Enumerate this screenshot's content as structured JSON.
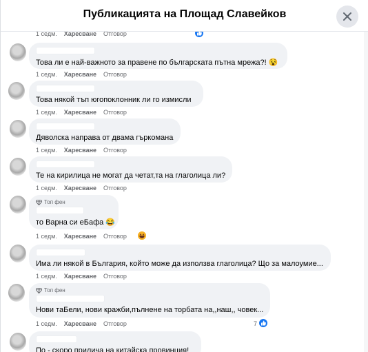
{
  "header": {
    "title": "Публикацията на Площад Славейков"
  },
  "comments": [
    {
      "time": "1 седм.",
      "like": "Харесване",
      "reply": "Отговор"
    },
    {
      "text": "Това ли е най-важното за правене по българската пътна мрежа?! 😵",
      "time": "1 седм.",
      "like": "Харесване",
      "reply": "Отговор"
    },
    {
      "text": "Това някой тъп югопоклонник ли го измисли",
      "time": "1 седм.",
      "like": "Харесване",
      "reply": "Отговор"
    },
    {
      "text": "Дяволска направа от двама гъркомана",
      "time": "1 седм.",
      "like": "Харесване",
      "reply": "Отговор"
    },
    {
      "text": "Те на кирилица не могат да четат,та на глаголица ли?",
      "time": "1 седм.",
      "like": "Харесване",
      "reply": "Отговор"
    },
    {
      "badge": "Топ фен",
      "text": "то Варна си еБафа 😂",
      "time": "1 седм.",
      "like": "Харесване",
      "reply": "Отговор"
    },
    {
      "text": "Има ли някой в България, който може да използва глаголица? Що за малоумие...",
      "time": "1 седм.",
      "like": "Харесване",
      "reply": "Отговор"
    },
    {
      "badge": "Топ фен",
      "text": "Нови таБели, нови кражби,пълнене на торбата на,,наш,, човек...",
      "time": "1 седм.",
      "like": "Харесване",
      "reply": "Отговор",
      "reaction_count": "7"
    },
    {
      "text": "По - скоро прилича на китайска провинция!"
    }
  ],
  "icons": {
    "close": "close-icon",
    "like": "like-reaction-icon",
    "haha": "haha-reaction-icon",
    "gem": "top-fan-gem-icon"
  },
  "colors": {
    "like_blue": "#1877f2",
    "haha_yellow": "#f7b125"
  }
}
